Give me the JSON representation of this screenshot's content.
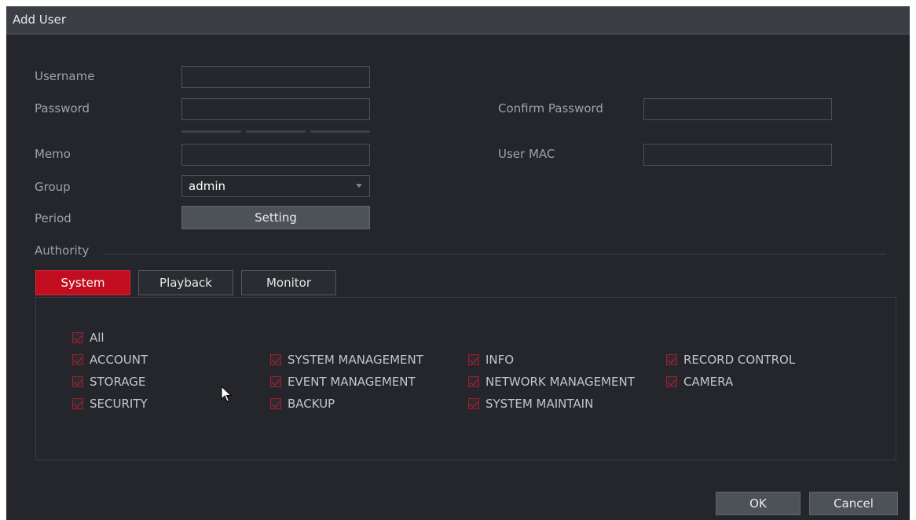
{
  "window": {
    "title": "Add User"
  },
  "form": {
    "username_label": "Username",
    "username_value": "",
    "password_label": "Password",
    "password_value": "",
    "confirm_password_label": "Confirm Password",
    "confirm_password_value": "",
    "memo_label": "Memo",
    "memo_value": "",
    "user_mac_label": "User MAC",
    "user_mac_value": "",
    "group_label": "Group",
    "group_value": "admin",
    "period_label": "Period",
    "period_button": "Setting"
  },
  "authority": {
    "label": "Authority",
    "tabs": [
      {
        "label": "System",
        "active": true
      },
      {
        "label": "Playback",
        "active": false
      },
      {
        "label": "Monitor",
        "active": false
      }
    ],
    "all_label": "All",
    "permissions": [
      {
        "label": "ACCOUNT",
        "checked": true
      },
      {
        "label": "SYSTEM MANAGEMENT",
        "checked": true
      },
      {
        "label": "INFO",
        "checked": true
      },
      {
        "label": "RECORD CONTROL",
        "checked": true
      },
      {
        "label": "STORAGE",
        "checked": true
      },
      {
        "label": "EVENT MANAGEMENT",
        "checked": true
      },
      {
        "label": "NETWORK MANAGEMENT",
        "checked": true
      },
      {
        "label": "CAMERA",
        "checked": true
      },
      {
        "label": "SECURITY",
        "checked": true
      },
      {
        "label": "BACKUP",
        "checked": true
      },
      {
        "label": "SYSTEM MAINTAIN",
        "checked": true
      }
    ]
  },
  "footer": {
    "ok_label": "OK",
    "cancel_label": "Cancel"
  },
  "colors": {
    "background": "#24262b",
    "titlebar": "#3b3e45",
    "accent_red": "#c20d20",
    "text": "#e6e6e6",
    "label_text": "#9fa2a8"
  },
  "icons": {
    "checkbox": "checkmark-icon",
    "dropdown": "chevron-down-icon",
    "pointer": "mouse-cursor-icon"
  }
}
